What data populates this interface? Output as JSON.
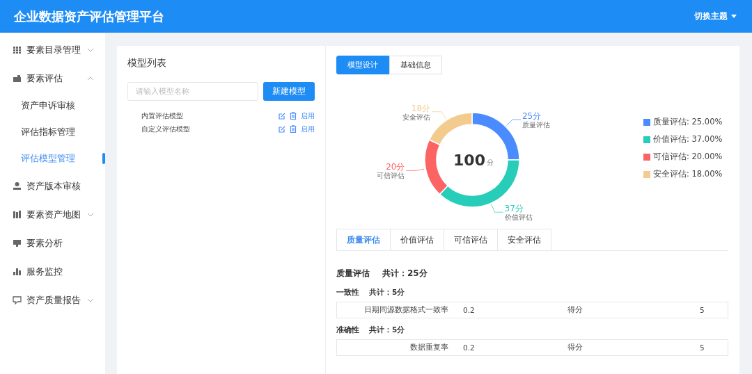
{
  "header": {
    "title": "企业数据资产评估管理平台",
    "theme_menu": "切换主题"
  },
  "sidebar": {
    "items": [
      {
        "label": "要素目录管理",
        "expanded": false
      },
      {
        "label": "要素评估",
        "expanded": true,
        "children": [
          {
            "label": "资产申诉审核",
            "selected": false
          },
          {
            "label": "评估指标管理",
            "selected": false
          },
          {
            "label": "评估模型管理",
            "selected": true
          }
        ]
      },
      {
        "label": "资产版本审核"
      },
      {
        "label": "要素资产地图",
        "expanded": false
      },
      {
        "label": "要素分析"
      },
      {
        "label": "服务监控"
      },
      {
        "label": "资产质量报告",
        "expanded": false
      }
    ]
  },
  "model_list": {
    "title": "模型列表",
    "search": {
      "placeholder": "请输入模型名称"
    },
    "new_button": "新建模型",
    "models": [
      {
        "name": "内置评估模型",
        "action": "启用"
      },
      {
        "name": "自定义评估模型",
        "action": "启用"
      }
    ]
  },
  "design": {
    "view_tabs": [
      {
        "label": "模型设计",
        "selected": true
      },
      {
        "label": "基础信息",
        "selected": false
      }
    ],
    "chart_data": {
      "type": "donut",
      "categories": [
        "质量评估",
        "价值评估",
        "可信评估",
        "安全评估"
      ],
      "values": [
        25,
        37,
        20,
        18
      ],
      "value_labels": [
        "25分",
        "37分",
        "20分",
        "18分"
      ]
    },
    "center_value": "100",
    "center_unit": "分",
    "legend": [
      {
        "label": "质量评估: 25.00%",
        "color": "#4a8cff"
      },
      {
        "label": "价值评估: 37.00%",
        "color": "#27cdb9"
      },
      {
        "label": "可信评估: 20.00%",
        "color": "#fc6464"
      },
      {
        "label": "安全评估: 18.00%",
        "color": "#f4cb8f"
      }
    ],
    "score_tabs": [
      {
        "label": "质量评估",
        "selected": true
      },
      {
        "label": "价值评估",
        "selected": false
      },
      {
        "label": "可信评估",
        "selected": false
      },
      {
        "label": "安全评估",
        "selected": false
      }
    ],
    "section": {
      "title": "质量评估",
      "total": "共计：25分"
    },
    "groups": [
      {
        "name": "一致性",
        "total": "共计：5分",
        "rows": [
          {
            "indicator": "日期同源数据格式一致率",
            "weight": "0.2",
            "score_label": "得分",
            "score": "5"
          }
        ]
      },
      {
        "name": "准确性",
        "total": "共计：5分",
        "rows": [
          {
            "indicator": "数据重复率",
            "weight": "0.2",
            "score_label": "得分",
            "score": "5"
          }
        ]
      }
    ]
  }
}
